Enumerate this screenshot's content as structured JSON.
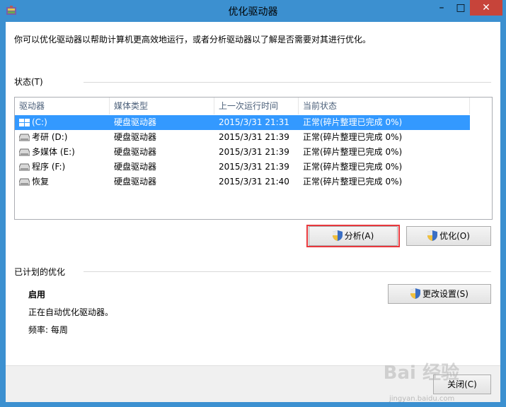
{
  "window": {
    "title": "优化驱动器"
  },
  "description": "你可以优化驱动器以帮助计算机更高效地运行，或者分析驱动器以了解是否需要对其进行优化。",
  "status": {
    "label": "状态(T)",
    "columns": [
      "驱动器",
      "媒体类型",
      "上一次运行时间",
      "当前状态"
    ],
    "rows": [
      {
        "drive": "(C:)",
        "media": "硬盘驱动器",
        "last_run": "2015/3/31 21:31",
        "state": "正常(碎片整理已完成 0%)",
        "icon": "windows-drive-icon",
        "selected": true
      },
      {
        "drive": "考研 (D:)",
        "media": "硬盘驱动器",
        "last_run": "2015/3/31 21:39",
        "state": "正常(碎片整理已完成 0%)",
        "icon": "drive-icon",
        "selected": false
      },
      {
        "drive": "多媒体 (E:)",
        "media": "硬盘驱动器",
        "last_run": "2015/3/31 21:39",
        "state": "正常(碎片整理已完成 0%)",
        "icon": "drive-icon",
        "selected": false
      },
      {
        "drive": "程序 (F:)",
        "media": "硬盘驱动器",
        "last_run": "2015/3/31 21:39",
        "state": "正常(碎片整理已完成 0%)",
        "icon": "drive-icon",
        "selected": false
      },
      {
        "drive": "恢复",
        "media": "硬盘驱动器",
        "last_run": "2015/3/31 21:40",
        "state": "正常(碎片整理已完成 0%)",
        "icon": "drive-icon",
        "selected": false
      }
    ]
  },
  "buttons": {
    "analyze": "分析(A)",
    "optimize": "优化(O)",
    "change_settings": "更改设置(S)",
    "close": "关闭(C)"
  },
  "scheduled": {
    "label": "已计划的优化",
    "state": "启用",
    "message": "正在自动优化驱动器。",
    "frequency": "频率: 每周"
  },
  "watermark": {
    "logo": "Bai 经验",
    "url": "jingyan.baidu.com"
  },
  "colors": {
    "selection": "#3399ff",
    "highlight_box": "#e8383d",
    "title_bar": "#3c90d0",
    "close_button": "#c7443a"
  }
}
